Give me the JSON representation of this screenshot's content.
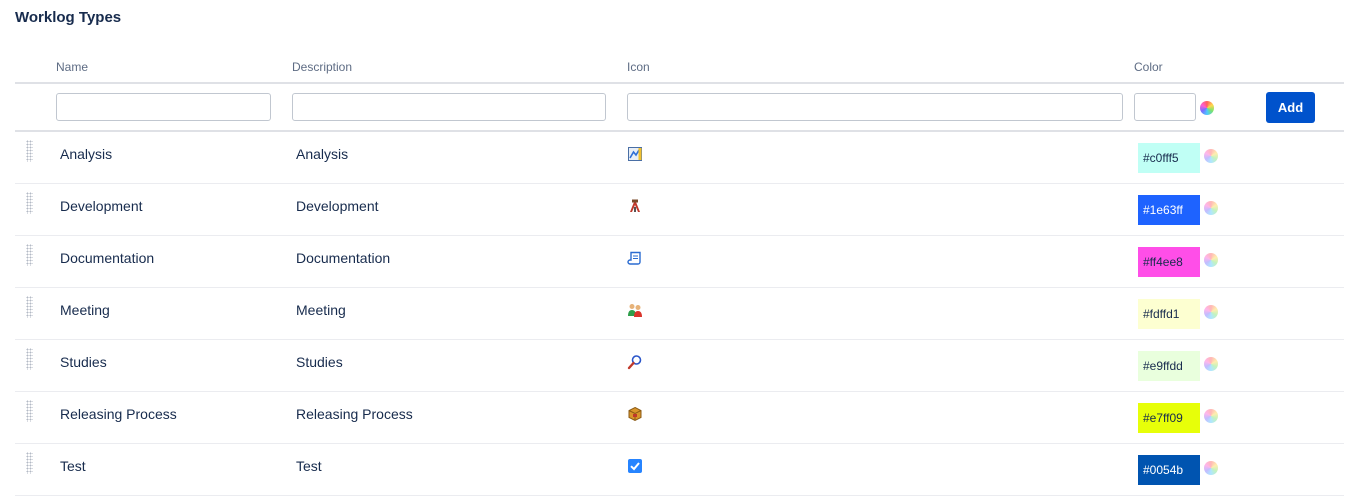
{
  "page": {
    "title": "Worklog Types"
  },
  "columns": {
    "name": "Name",
    "description": "Description",
    "icon": "Icon",
    "color": "Color"
  },
  "add_form": {
    "name_value": "",
    "description_value": "",
    "icon_value": "",
    "color_value": "",
    "add_label": "Add"
  },
  "rows": [
    {
      "name": "Analysis",
      "description": "Analysis",
      "icon": "chart-document-icon",
      "color_label": "#c0fff5",
      "bg": "#c0fff5",
      "fg": "#172b4d"
    },
    {
      "name": "Development",
      "description": "Development",
      "icon": "tools-icon",
      "color_label": "#1e63ff",
      "bg": "#1e63ff",
      "fg": "#ffffff"
    },
    {
      "name": "Documentation",
      "description": "Documentation",
      "icon": "scroll-icon",
      "color_label": "#ff4ee8",
      "bg": "#ff4ee8",
      "fg": "#172b4d"
    },
    {
      "name": "Meeting",
      "description": "Meeting",
      "icon": "people-icon",
      "color_label": "#fdffd1",
      "bg": "#fdffd1",
      "fg": "#172b4d"
    },
    {
      "name": "Studies",
      "description": "Studies",
      "icon": "magnifier-icon",
      "color_label": "#e9ffdd",
      "bg": "#e9ffdd",
      "fg": "#172b4d"
    },
    {
      "name": "Releasing Process",
      "description": "Releasing Process",
      "icon": "package-icon",
      "color_label": "#e7ff09",
      "bg": "#e7ff09",
      "fg": "#172b4d"
    },
    {
      "name": "Test",
      "description": "Test",
      "icon": "checkbox-icon",
      "color_label": "#0054b",
      "bg": "#0054b0",
      "fg": "#ffffff"
    }
  ]
}
